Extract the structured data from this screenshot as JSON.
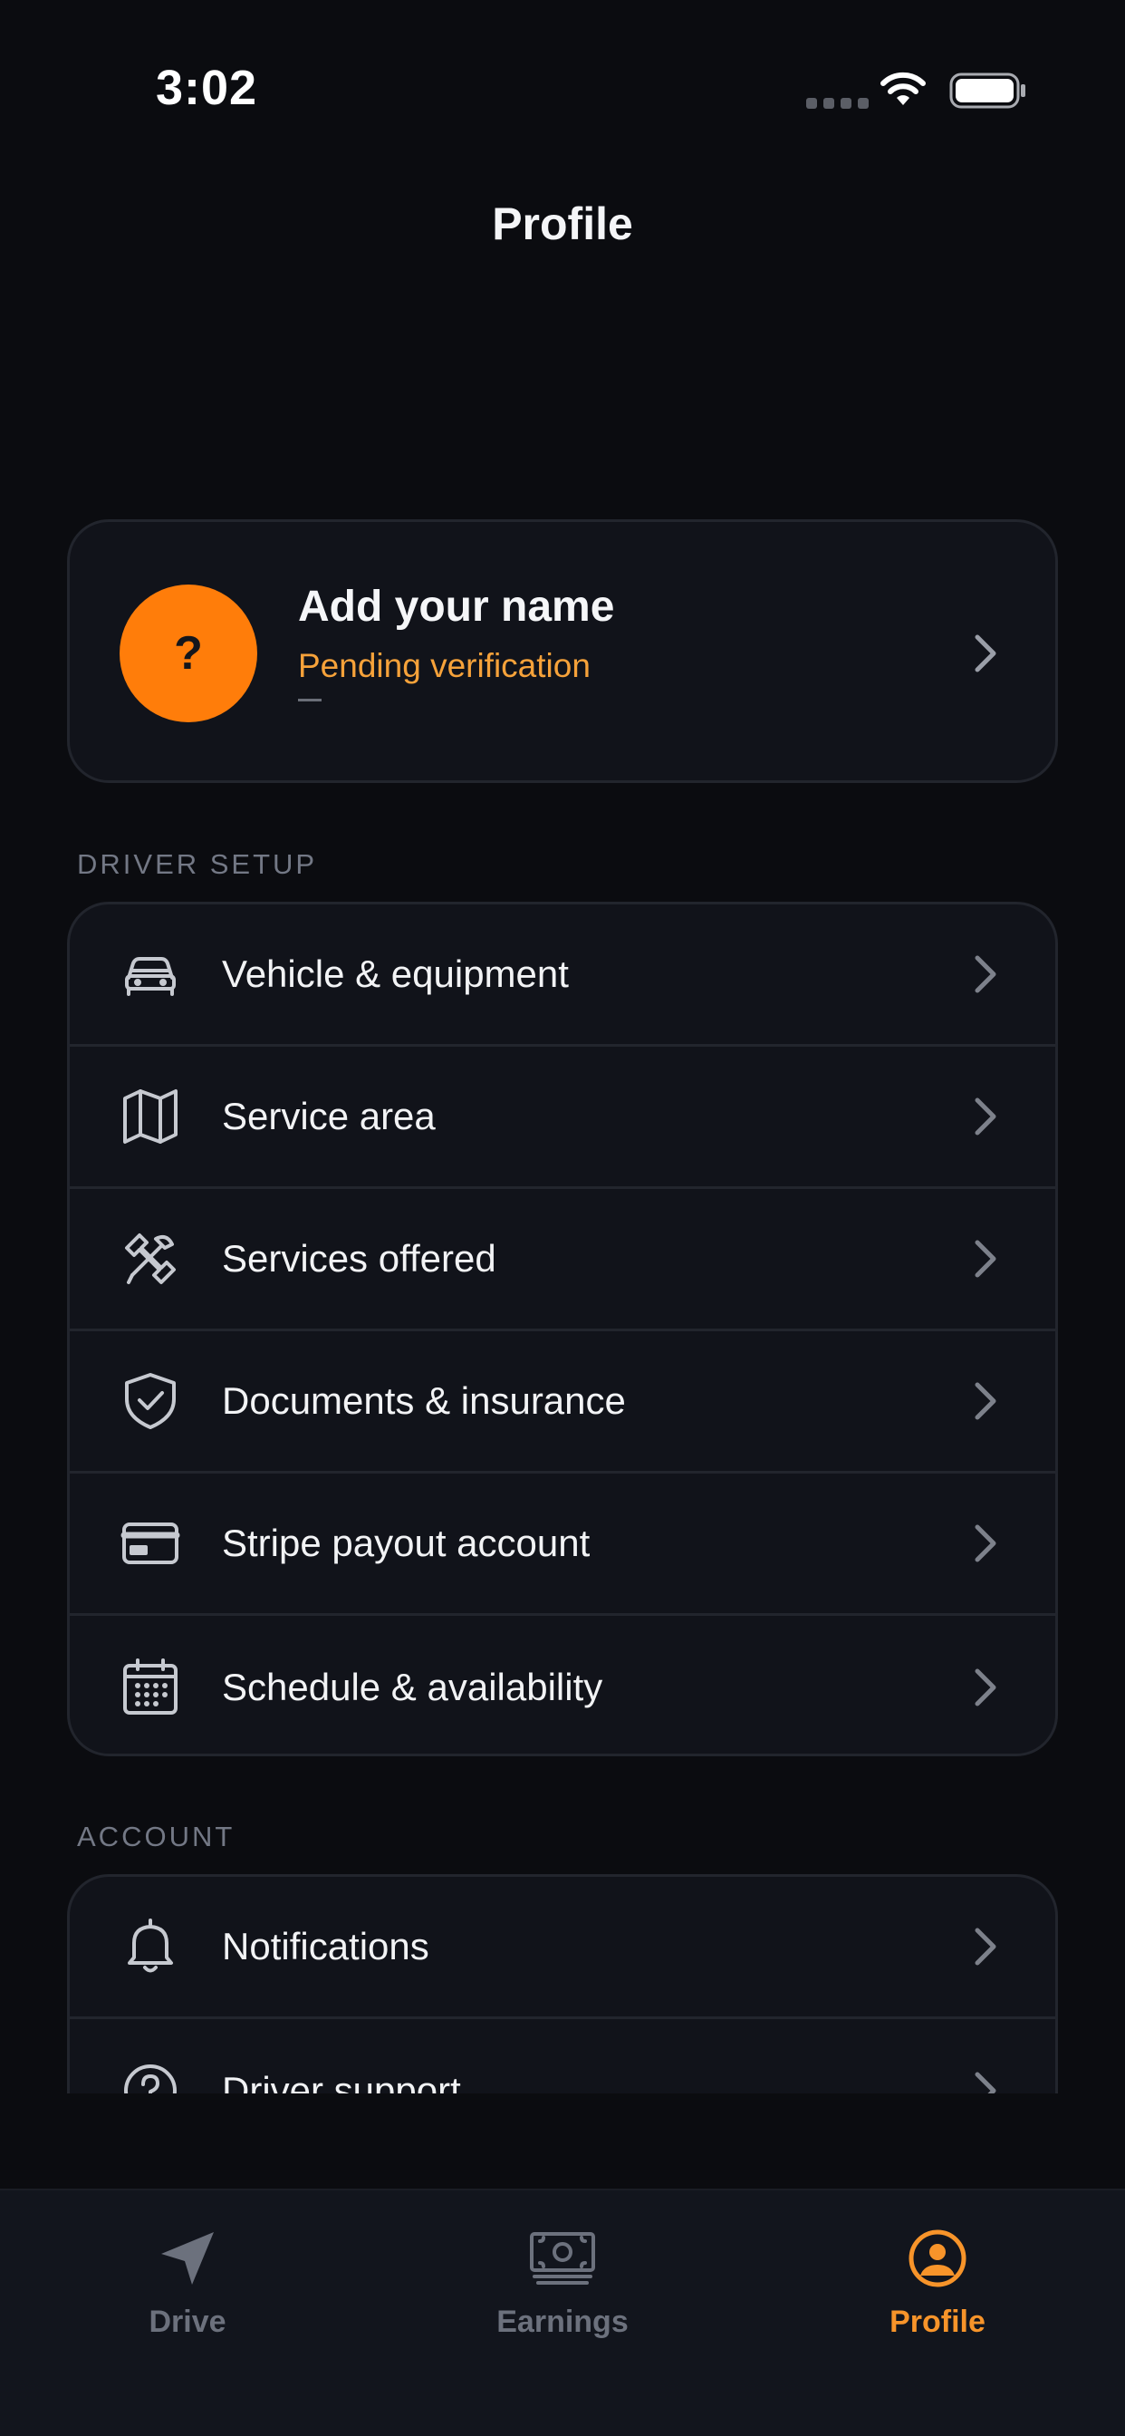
{
  "status_bar": {
    "time": "3:02"
  },
  "header": {
    "title": "Profile"
  },
  "profile": {
    "avatar_glyph": "?",
    "name": "Add your name",
    "status": "Pending verification",
    "secondary": ""
  },
  "sections": {
    "driver_setup": {
      "label": "DRIVER SETUP",
      "items": [
        {
          "label": "Vehicle & equipment",
          "icon": "car-icon"
        },
        {
          "label": "Service area",
          "icon": "map-icon"
        },
        {
          "label": "Services offered",
          "icon": "tools-icon"
        },
        {
          "label": "Documents & insurance",
          "icon": "shield-check-icon"
        },
        {
          "label": "Stripe payout account",
          "icon": "credit-card-icon"
        },
        {
          "label": "Schedule & availability",
          "icon": "calendar-icon"
        }
      ]
    },
    "account": {
      "label": "ACCOUNT",
      "items": [
        {
          "label": "Notifications",
          "icon": "bell-icon"
        },
        {
          "label": "Driver support",
          "icon": "help-circle-icon"
        }
      ]
    }
  },
  "tab_bar": {
    "tabs": [
      {
        "label": "Drive",
        "icon": "navigation-arrow-icon",
        "active": false
      },
      {
        "label": "Earnings",
        "icon": "cash-icon",
        "active": false
      },
      {
        "label": "Profile",
        "icon": "user-circle-icon",
        "active": true
      }
    ]
  },
  "colors": {
    "background": "#0b0c10",
    "card": "#11131a",
    "accent": "#ff7d0a",
    "pending": "#f6a23a",
    "muted": "#6c717d"
  }
}
